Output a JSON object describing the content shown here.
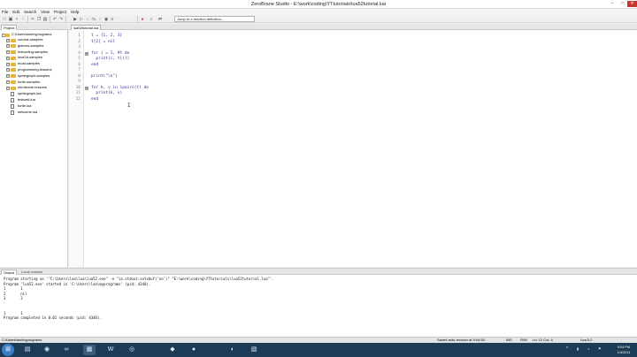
{
  "window": {
    "title": "ZeroBrane Studio - E:\\work\\coding\\YTtutorials\\lua52tutorial.lua",
    "controls": [
      "–",
      "□",
      "✕"
    ]
  },
  "menu": [
    "File",
    "Edit",
    "Search",
    "View",
    "Project",
    "Help"
  ],
  "toolbar": {
    "icons": [
      {
        "name": "new-file-icon",
        "glyph": "□"
      },
      {
        "name": "open-file-icon",
        "glyph": "▣"
      },
      {
        "name": "save-icon",
        "glyph": "▪"
      },
      {
        "name": "save-all-icon",
        "glyph": "▫"
      },
      {
        "name": "cut-icon",
        "glyph": "✂"
      },
      {
        "name": "copy-icon",
        "glyph": "❐"
      },
      {
        "name": "paste-icon",
        "glyph": "▤"
      },
      {
        "name": "undo-icon",
        "glyph": "↶"
      },
      {
        "name": "redo-icon",
        "glyph": "↷"
      },
      {
        "name": "run-icon",
        "glyph": "▶"
      },
      {
        "name": "debug-icon",
        "glyph": "▷"
      },
      {
        "name": "step-into-icon",
        "glyph": "↓"
      },
      {
        "name": "step-over-icon",
        "glyph": "⤼"
      },
      {
        "name": "step-out-icon",
        "glyph": "↑"
      },
      {
        "name": "watch-icon",
        "glyph": "◉"
      },
      {
        "name": "stack-icon",
        "glyph": "≡"
      },
      {
        "name": "breakpoint-icon",
        "glyph": "●"
      },
      {
        "name": "find-icon",
        "glyph": "⌕"
      },
      {
        "name": "replace-icon",
        "glyph": "⇄"
      }
    ],
    "jump_placeholder": "Jump to a function definition..."
  },
  "project": {
    "tab_label": "Project",
    "root": "C:\\Users\\lan\\myprograms",
    "folders": [
      "corona-samples",
      "gideros-samples",
      "livecoding-samples",
      "love2d-samples",
      "moai-samples",
      "programming-lessons",
      "spritegraph-samples",
      "turtle-samples",
      "zerobrane-lessons"
    ],
    "files": [
      "spritegraph.lua",
      "testwell.lua",
      "turtle.lua",
      "welcome.lua"
    ]
  },
  "editor": {
    "tab_label": "lua52tutorial.lua",
    "lines": [
      {
        "num": "1",
        "fold": "",
        "text": "t = {1, 2, 3}"
      },
      {
        "num": "2",
        "fold": "",
        "text": "t[2] = nil"
      },
      {
        "num": "3",
        "fold": "",
        "text": ""
      },
      {
        "num": "4",
        "fold": "⊟",
        "text": "for i = 1, #t do"
      },
      {
        "num": "5",
        "fold": "",
        "text": "  print(i, t[i])"
      },
      {
        "num": "6",
        "fold": "",
        "text": "end"
      },
      {
        "num": "7",
        "fold": "",
        "text": ""
      },
      {
        "num": "8",
        "fold": "",
        "text": "print(\"\\n\")"
      },
      {
        "num": "9",
        "fold": "",
        "text": ""
      },
      {
        "num": "10",
        "fold": "⊟",
        "text": "for k, v in ipairs(t) do"
      },
      {
        "num": "11",
        "fold": "",
        "text": "  print(k, v)"
      },
      {
        "num": "12",
        "fold": "",
        "text": "end"
      }
    ]
  },
  "output": {
    "tabs": [
      "Output",
      "Local console"
    ],
    "lines": [
      "Program starting as '\"C:\\Users\\lan\\lua\\lua52.exe\" -e \"io.stdout:setvbuf('no')\" \"E:\\work\\coding\\YTtutorials\\lua52tutorial.lua\"'.",
      "Program 'lua52.exe' started in 'C:\\Users\\lan\\myprograms' (pid: 4340).",
      "1       1",
      "2       nil",
      "3       3",
      "",
      "",
      "1       1",
      "Program completed in 0.01 seconds (pid: 4340)."
    ]
  },
  "status": {
    "path": "C:\\Users\\lan\\myprograms",
    "autorecover": "Saved auto-recover at 9:04:50.",
    "ins": "INS",
    "rw": "R/W",
    "position": "Ln: 12 Col: 4",
    "interpreter": "Lua 5.2"
  },
  "taskbar": {
    "start_glyph": "⊞",
    "apps": [
      {
        "name": "file-explorer-icon",
        "glyph": "▤"
      },
      {
        "name": "firefox-icon",
        "glyph": "◉"
      },
      {
        "name": "visual-studio-icon",
        "glyph": "∞"
      },
      {
        "name": "zerobrane-icon",
        "glyph": "▦"
      },
      {
        "name": "word-icon",
        "glyph": "W"
      },
      {
        "name": "steam-icon",
        "glyph": "◎"
      },
      {
        "name": "app-icon",
        "glyph": "◆"
      },
      {
        "name": "media-icon",
        "glyph": "●"
      },
      {
        "name": "record-icon",
        "glyph": "◐"
      },
      {
        "name": "paint-icon",
        "glyph": "▧"
      }
    ],
    "tray_arrow": "^",
    "time": "9:04 PM",
    "date": "1/4/2014"
  }
}
